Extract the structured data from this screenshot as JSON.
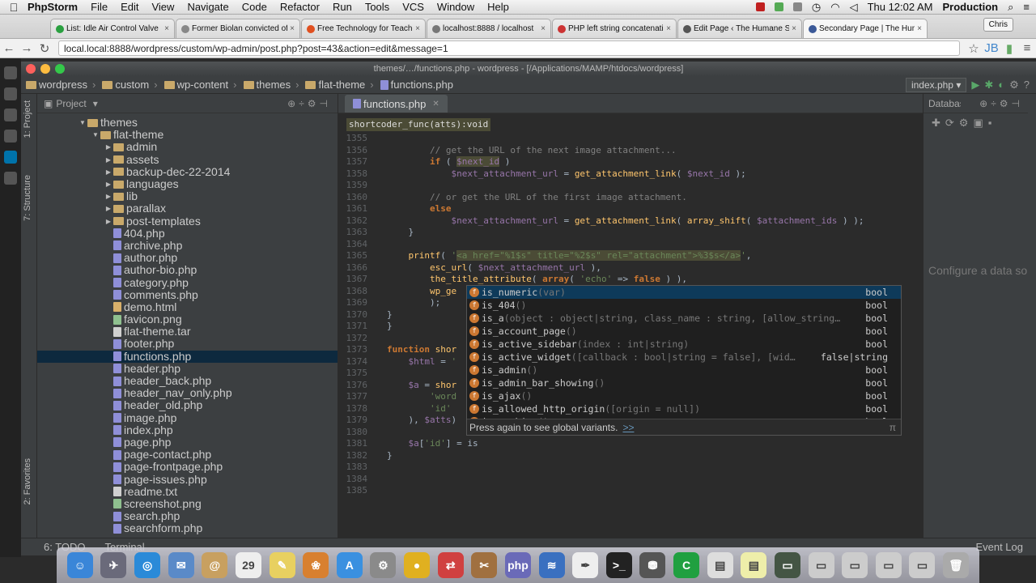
{
  "mac_menu": {
    "app": "PhpStorm",
    "items": [
      "File",
      "Edit",
      "View",
      "Navigate",
      "Code",
      "Refactor",
      "Run",
      "Tools",
      "VCS",
      "Window",
      "Help"
    ],
    "clock": "Thu 12:02 AM",
    "profile": "Production"
  },
  "browser": {
    "user": "Chris",
    "tabs": [
      {
        "title": "List: Idle Air Control Valve",
        "color": "#2aa040"
      },
      {
        "title": "Former Biolan convicted of",
        "color": "#888888"
      },
      {
        "title": "Free Technology for Teachers",
        "color": "#e05020"
      },
      {
        "title": "localhost:8888 / localhost",
        "color": "#777777"
      },
      {
        "title": "PHP left string concatenation",
        "color": "#cc3333"
      },
      {
        "title": "Edit Page ‹ The Humane Society",
        "color": "#555555"
      },
      {
        "title": "Secondary Page | The Humane",
        "color": "#3b5998"
      }
    ],
    "url": "local.local:8888/wordpress/custom/wp-admin/post.php?post=43&action=edit&message=1"
  },
  "ide": {
    "window_title": "themes/…/functions.php - wordpress - [/Applications/MAMP/htdocs/wordpress]",
    "breadcrumbs": [
      "wordpress",
      "custom",
      "wp-content",
      "themes",
      "flat-theme",
      "functions.php"
    ],
    "run_config": "index.php",
    "project_label": "Project",
    "tool_tabs": {
      "project": "1: Project",
      "structure": "7: Structure",
      "favorites": "2: Favorites"
    },
    "tree": [
      {
        "label": "themes",
        "type": "folder",
        "depth": 0,
        "open": true
      },
      {
        "label": "flat-theme",
        "type": "folder",
        "depth": 1,
        "open": true
      },
      {
        "label": "admin",
        "type": "folder",
        "depth": 2
      },
      {
        "label": "assets",
        "type": "folder",
        "depth": 2
      },
      {
        "label": "backup-dec-22-2014",
        "type": "folder",
        "depth": 2
      },
      {
        "label": "languages",
        "type": "folder",
        "depth": 2
      },
      {
        "label": "lib",
        "type": "folder",
        "depth": 2
      },
      {
        "label": "parallax",
        "type": "folder",
        "depth": 2
      },
      {
        "label": "post-templates",
        "type": "folder",
        "depth": 2
      },
      {
        "label": "404.php",
        "type": "php",
        "depth": 2
      },
      {
        "label": "archive.php",
        "type": "php",
        "depth": 2
      },
      {
        "label": "author.php",
        "type": "php",
        "depth": 2
      },
      {
        "label": "author-bio.php",
        "type": "php",
        "depth": 2
      },
      {
        "label": "category.php",
        "type": "php",
        "depth": 2
      },
      {
        "label": "comments.php",
        "type": "php",
        "depth": 2
      },
      {
        "label": "demo.html",
        "type": "html",
        "depth": 2
      },
      {
        "label": "favicon.png",
        "type": "img",
        "depth": 2
      },
      {
        "label": "flat-theme.tar",
        "type": "file",
        "depth": 2
      },
      {
        "label": "footer.php",
        "type": "php",
        "depth": 2
      },
      {
        "label": "functions.php",
        "type": "php",
        "depth": 2,
        "selected": true
      },
      {
        "label": "header.php",
        "type": "php",
        "depth": 2
      },
      {
        "label": "header_back.php",
        "type": "php",
        "depth": 2
      },
      {
        "label": "header_nav_only.php",
        "type": "php",
        "depth": 2
      },
      {
        "label": "header_old.php",
        "type": "php",
        "depth": 2
      },
      {
        "label": "image.php",
        "type": "php",
        "depth": 2
      },
      {
        "label": "index.php",
        "type": "php",
        "depth": 2
      },
      {
        "label": "page.php",
        "type": "php",
        "depth": 2
      },
      {
        "label": "page-contact.php",
        "type": "php",
        "depth": 2
      },
      {
        "label": "page-frontpage.php",
        "type": "php",
        "depth": 2
      },
      {
        "label": "page-issues.php",
        "type": "php",
        "depth": 2
      },
      {
        "label": "readme.txt",
        "type": "file",
        "depth": 2
      },
      {
        "label": "screenshot.png",
        "type": "img",
        "depth": 2
      },
      {
        "label": "search.php",
        "type": "php",
        "depth": 2
      },
      {
        "label": "searchform.php",
        "type": "php",
        "depth": 2
      }
    ],
    "editor_tab": "functions.php",
    "signature": "shortcoder_func(atts):void",
    "code": [
      {
        "n": "1355",
        "t": ""
      },
      {
        "n": "1356",
        "t": "<span class=\"c\">        // get the URL of the next image attachment...</span>"
      },
      {
        "n": "1357",
        "t": "        <span class=\"k\">if</span> ( <span class=\"v hs\">$next_id</span> )"
      },
      {
        "n": "1358",
        "t": "            <span class=\"v\">$next_attachment_url</span> = <span class=\"f\">get_attachment_link</span>( <span class=\"v\">$next_id</span> );"
      },
      {
        "n": "1359",
        "t": ""
      },
      {
        "n": "1360",
        "t": "<span class=\"c\">        // or get the URL of the first image attachment.</span>"
      },
      {
        "n": "1361",
        "t": "        <span class=\"k\">else</span>"
      },
      {
        "n": "1362",
        "t": "            <span class=\"v\">$next_attachment_url</span> = <span class=\"f\">get_attachment_link</span>( <span class=\"f\">array_shift</span>( <span class=\"v\">$attachment_ids</span> ) );"
      },
      {
        "n": "1363",
        "t": "    }"
      },
      {
        "n": "1364",
        "t": ""
      },
      {
        "n": "1365",
        "t": "    <span class=\"f\">printf</span>( <span class=\"s\">'<span class=\"hs\">&lt;a href=\"%1$s\" title=\"%2$s\" rel=\"attachment\"&gt;%3$s&lt;/a&gt;</span>'</span>,"
      },
      {
        "n": "1366",
        "t": "        <span class=\"f\">esc_url</span>( <span class=\"v\">$next_attachment_url</span> ),"
      },
      {
        "n": "1367",
        "t": "        <span class=\"f\">the_title_attribute</span>( <span class=\"k\">array</span>( <span class=\"s\">'echo'</span> =&gt; <span class=\"k\">false</span> ) ),"
      },
      {
        "n": "1368",
        "t": "        <span class=\"f\">wp_ge</span>"
      },
      {
        "n": "1369",
        "t": "        );"
      },
      {
        "n": "1370",
        "t": "}"
      },
      {
        "n": "1371",
        "t": "}"
      },
      {
        "n": "1372",
        "t": ""
      },
      {
        "n": "1373",
        "t": "<span class=\"k\">function</span> <span class=\"f\">shor</span>"
      },
      {
        "n": "1374",
        "t": "    <span class=\"v\">$html</span> = <span class=\"s\">'</span>"
      },
      {
        "n": "1375",
        "t": ""
      },
      {
        "n": "1376",
        "t": "    <span class=\"v\">$a</span> = <span class=\"f\">shor</span>"
      },
      {
        "n": "1377",
        "t": "        <span class=\"s\">'word</span>"
      },
      {
        "n": "1378",
        "t": "        <span class=\"s\">'id'</span>"
      },
      {
        "n": "1379",
        "t": "    ), <span class=\"v\">$atts</span>)"
      },
      {
        "n": "1380",
        "t": ""
      },
      {
        "n": "1381",
        "t": "    <span class=\"v\">$a</span>[<span class=\"s\">'id'</span>] = is"
      },
      {
        "n": "1382",
        "t": "}"
      },
      {
        "n": "1383",
        "t": ""
      },
      {
        "n": "1384",
        "t": ""
      },
      {
        "n": "1385",
        "t": ""
      }
    ],
    "completion": {
      "items": [
        {
          "name": "is_numeric",
          "params": "(var)",
          "type": "bool"
        },
        {
          "name": "is_404",
          "params": "()",
          "type": "bool"
        },
        {
          "name": "is_a",
          "params": "(object : object|string, class_name : string, [allow_string…",
          "type": "bool"
        },
        {
          "name": "is_account_page",
          "params": "()",
          "type": "bool"
        },
        {
          "name": "is_active_sidebar",
          "params": "(index : int|string)",
          "type": "bool"
        },
        {
          "name": "is_active_widget",
          "params": "([callback : bool|string = false], [wid…",
          "type": "false|string"
        },
        {
          "name": "is_admin",
          "params": "()",
          "type": "bool"
        },
        {
          "name": "is_admin_bar_showing",
          "params": "()",
          "type": "bool"
        },
        {
          "name": "is_ajax",
          "params": "()",
          "type": "bool"
        },
        {
          "name": "is_allowed_http_origin",
          "params": "([origin = null])",
          "type": "bool"
        },
        {
          "name": "is_archive",
          "params": "()",
          "type": "bool"
        }
      ],
      "footer": "Press again to see global variants.",
      "more": ">>",
      "pi": "π"
    },
    "right_panel": {
      "title": "Database",
      "empty_msg": "Configure a data source with"
    },
    "bottom_tools": {
      "todo": "6: TODO",
      "terminal": "Terminal",
      "event_log": "Event Log"
    }
  },
  "dock": [
    {
      "name": "finder-icon",
      "color": "#3a86d8",
      "glyph": "☺"
    },
    {
      "name": "launchpad-icon",
      "color": "#6a6a7a",
      "glyph": "✈"
    },
    {
      "name": "safari-icon",
      "color": "#2a8ad8",
      "glyph": "◎"
    },
    {
      "name": "mail-icon",
      "color": "#5a8ac8",
      "glyph": "✉"
    },
    {
      "name": "contacts-icon",
      "color": "#c8a060",
      "glyph": "@"
    },
    {
      "name": "calendar-icon",
      "color": "#eeeeee",
      "glyph": "29"
    },
    {
      "name": "notes-icon",
      "color": "#e8d060",
      "glyph": "✎"
    },
    {
      "name": "photos-icon",
      "color": "#d88030",
      "glyph": "❀"
    },
    {
      "name": "appstore-icon",
      "color": "#3a90e0",
      "glyph": "A"
    },
    {
      "name": "settings-icon",
      "color": "#8a8a8a",
      "glyph": "⚙"
    },
    {
      "name": "chrome-icon",
      "color": "#e0b020",
      "glyph": "●"
    },
    {
      "name": "remote-icon",
      "color": "#d04040",
      "glyph": "⇄"
    },
    {
      "name": "utility-icon",
      "color": "#a07040",
      "glyph": "✂"
    },
    {
      "name": "php-icon",
      "color": "#6a6ab8",
      "glyph": "php"
    },
    {
      "name": "filezilla-icon",
      "color": "#3a70c0",
      "glyph": "≋"
    },
    {
      "name": "textedit-icon",
      "color": "#eeeeee",
      "glyph": "✒"
    },
    {
      "name": "terminal-icon",
      "color": "#222222",
      "glyph": ">_"
    },
    {
      "name": "sequel-icon",
      "color": "#555555",
      "glyph": "⛃"
    },
    {
      "name": "phpstorm-icon",
      "color": "#20a040",
      "glyph": "C"
    },
    {
      "name": "doc-icon",
      "color": "#dddddd",
      "glyph": "▤"
    },
    {
      "name": "doc-icon-2",
      "color": "#eeeeaa",
      "glyph": "▤"
    },
    {
      "name": "screen-icon",
      "color": "#445544",
      "glyph": "▭"
    },
    {
      "name": "screen-icon-2",
      "color": "#cccccc",
      "glyph": "▭"
    },
    {
      "name": "screen-icon-3",
      "color": "#cccccc",
      "glyph": "▭"
    },
    {
      "name": "screen-icon-4",
      "color": "#cccccc",
      "glyph": "▭"
    },
    {
      "name": "screen-icon-5",
      "color": "#cccccc",
      "glyph": "▭"
    },
    {
      "name": "trash-icon",
      "color": "#aaaaaa",
      "glyph": "🗑"
    }
  ],
  "colors": {
    "accent": "#0d293e",
    "keyword": "#cc7832",
    "string": "#6a8759"
  }
}
